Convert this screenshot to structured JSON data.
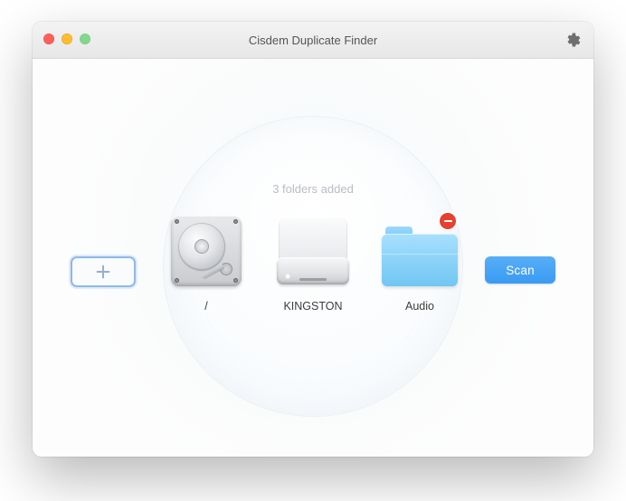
{
  "window": {
    "title": "Cisdem Duplicate Finder"
  },
  "toolbar": {
    "add_label": "Add",
    "scan_label": "Scan"
  },
  "folders": {
    "caption": "3 folders added",
    "items": [
      {
        "label": "/",
        "icon": "internal-drive",
        "removable": false
      },
      {
        "label": "KINGSTON",
        "icon": "external-drive",
        "removable": false
      },
      {
        "label": "Audio",
        "icon": "folder",
        "removable": true
      }
    ]
  }
}
